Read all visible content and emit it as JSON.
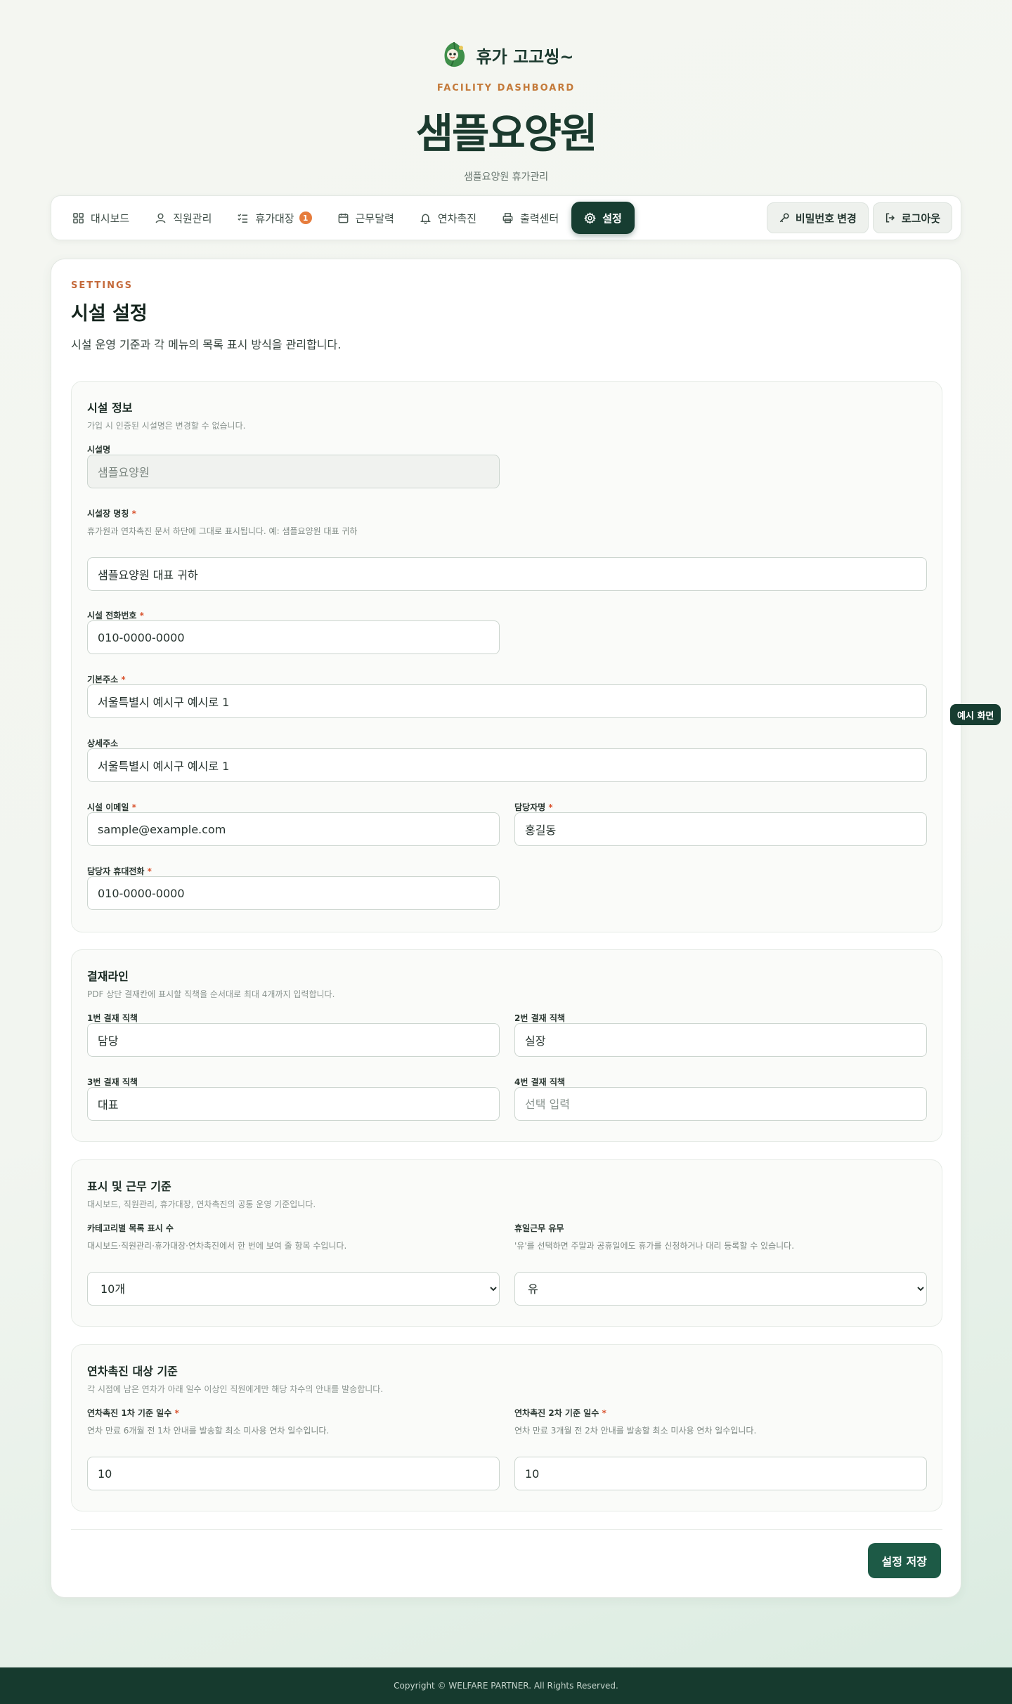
{
  "brand": {
    "name": "휴가 고고씽~",
    "logo_icon": "leaf-mascot-icon"
  },
  "hero": {
    "eyebrow": "FACILITY DASHBOARD",
    "title": "샘플요양원",
    "subtitle": "샘플요양원 휴가관리"
  },
  "nav": {
    "items": [
      {
        "label": "대시보드",
        "icon": "grid-icon"
      },
      {
        "label": "직원관리",
        "icon": "user-icon"
      },
      {
        "label": "휴가대장",
        "icon": "checklist-icon",
        "badge": "1"
      },
      {
        "label": "근무달력",
        "icon": "calendar-icon"
      },
      {
        "label": "연차촉진",
        "icon": "bell-icon"
      },
      {
        "label": "출력센터",
        "icon": "printer-icon"
      },
      {
        "label": "설정",
        "icon": "gear-icon",
        "active": true
      }
    ],
    "change_password": "비밀번호 변경",
    "logout": "로그아웃"
  },
  "settings": {
    "eyebrow": "SETTINGS",
    "title": "시설 설정",
    "description": "시설 운영 기준과 각 메뉴의 목록 표시 방식을 관리합니다."
  },
  "facility_info": {
    "title": "시설 정보",
    "description": "가입 시 인증된 시설명은 변경할 수 없습니다.",
    "facility_name": {
      "label": "시설명",
      "value": "샘플요양원"
    },
    "director_title": {
      "label": "시설장 명칭",
      "help": "휴가원과 연차촉진 문서 하단에 그대로 표시됩니다. 예: 샘플요양원 대표 귀하",
      "value": "샘플요양원 대표 귀하"
    },
    "phone": {
      "label": "시설 전화번호",
      "value": "010-0000-0000"
    },
    "address": {
      "label": "기본주소",
      "value": "서울특별시 예시구 예시로 1"
    },
    "address_detail": {
      "label": "상세주소",
      "value": "서울특별시 예시구 예시로 1"
    },
    "email": {
      "label": "시설 이메일",
      "value": "sample@example.com"
    },
    "manager_name": {
      "label": "담당자명",
      "value": "홍길동"
    },
    "manager_phone": {
      "label": "담당자 휴대전화",
      "value": "010-0000-0000"
    }
  },
  "approval": {
    "title": "결재라인",
    "description": "PDF 상단 결재칸에 표시할 직책을 순서대로 최대 4개까지 입력합니다.",
    "line1": {
      "label": "1번 결재 직책",
      "value": "담당"
    },
    "line2": {
      "label": "2번 결재 직책",
      "value": "실장"
    },
    "line3": {
      "label": "3번 결재 직책",
      "value": "대표"
    },
    "line4": {
      "label": "4번 결재 직책",
      "placeholder": "선택 입력"
    }
  },
  "display": {
    "title": "표시 및 근무 기준",
    "description": "대시보드, 직원관리, 휴가대장, 연차촉진의 공통 운영 기준입니다.",
    "per_page": {
      "label": "카테고리별 목록 표시 수",
      "help": "대시보드·직원관리·휴가대장·연차촉진에서 한 번에 보여 줄 항목 수입니다.",
      "value": "10개"
    },
    "holiday_work": {
      "label": "휴일근무 유무",
      "help": "'유'를 선택하면 주말과 공휴일에도 휴가를 신청하거나 대리 등록할 수 있습니다.",
      "value": "유"
    }
  },
  "promotion": {
    "title": "연차촉진 대상 기준",
    "description": "각 시점에 남은 연차가 아래 일수 이상인 직원에게만 해당 차수의 안내를 발송합니다.",
    "first": {
      "label": "연차촉진 1차 기준 일수",
      "help": "연차 만료 6개월 전 1차 안내를 발송할 최소 미사용 연차 일수입니다.",
      "value": "10"
    },
    "second": {
      "label": "연차촉진 2차 기준 일수",
      "help": "연차 만료 3개월 전 2차 안내를 발송할 최소 미사용 연차 일수입니다.",
      "value": "10"
    }
  },
  "save_label": "설정 저장",
  "demo_tag": "예시 화면",
  "footer": "Copyright © WELFARE PARTNER. All Rights Reserved.",
  "colors": {
    "primary": "#173d31",
    "accent": "#c4693a",
    "save": "#1d5a46",
    "badge": "#e67c3c",
    "required": "#d9532f"
  }
}
